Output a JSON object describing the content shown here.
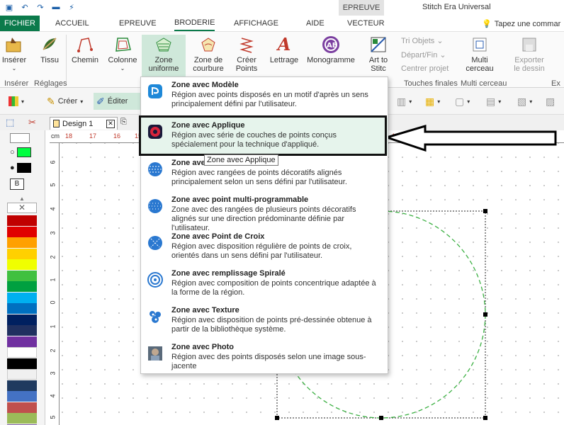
{
  "titlebar": {
    "context_tab": "EPREUVE",
    "app_title": "Stitch Era Universal",
    "qat_icons": [
      "save-icon",
      "undo-icon",
      "redo-icon",
      "folder-icon",
      "wand-icon"
    ]
  },
  "tabs": {
    "file": "FICHIER",
    "items": [
      "ACCUEIL",
      "EPREUVE",
      "BRODERIE",
      "AFFICHAGE",
      "AIDE",
      "VECTEUR"
    ],
    "active": "BRODERIE",
    "tellme": "Tapez une commar"
  },
  "ribbon": {
    "btn_inserer": "Insérer",
    "btn_tissu": "Tissu",
    "btn_chemin": "Chemin",
    "btn_colonne": "Colonne",
    "btn_zone_uniforme_1": "Zone",
    "btn_zone_uniforme_2": "uniforme",
    "btn_zone_courbure_1": "Zone de",
    "btn_zone_courbure_2": "courbure",
    "btn_creer_points_1": "Créer",
    "btn_creer_points_2": "Points",
    "btn_lettrage": "Lettrage",
    "btn_monogramme": "Monogramme",
    "btn_art_stitch_1": "Art to",
    "btn_art_stitch_2": "Stitc",
    "small_tri": "Tri Objets",
    "small_depart": "Départ/Fin",
    "small_centrer": "Centrer projet",
    "btn_multi_1": "Multi",
    "btn_multi_2": "cerceau",
    "btn_exporter_1": "Exporter",
    "btn_exporter_2": "le dessin",
    "grp_inserer": "Insérer",
    "grp_reglages": "Réglages",
    "grp_touches": "Touches finales",
    "grp_multi": "Multi cerceau",
    "grp_ex": "Ex"
  },
  "toolbar2": {
    "creer": "Créer",
    "editer": "Éditer"
  },
  "doc": {
    "tab_label": "Design 1"
  },
  "ruler": {
    "unit": "cm",
    "h_ticks": [
      "18",
      "17",
      "16",
      "15",
      "4",
      "2",
      "1",
      "0",
      "1",
      "2"
    ],
    "v_ticks": [
      "6",
      "5",
      "4",
      "3",
      "2",
      "1",
      "0",
      "1",
      "2",
      "3",
      "4",
      "5"
    ]
  },
  "palette": {
    "b_label": "B",
    "colors": [
      "#c00000",
      "#e00000",
      "#ffa000",
      "#ffd000",
      "#f0ff00",
      "#40c040",
      "#00a040",
      "#00b0f0",
      "#0070c0",
      "#002060",
      "#203060",
      "#7030a0",
      "#ffffff",
      "#000000",
      "#f0f0f0",
      "#1f3a5f",
      "#4472c4",
      "#c0504d",
      "#9bbb59",
      "#8064a2"
    ],
    "accent_green": "#00ff40"
  },
  "menu": {
    "items": [
      {
        "title": "Zone avec Modèle",
        "desc": "Région avec points disposés en un motif d'après un sens principalement défini par l'utilisateur.",
        "icon": "modele-icon"
      },
      {
        "title": "Zone avec Applique",
        "desc": "Région avec série de couches de points conçus spécialement pour la technique d'appliqué.",
        "icon": "applique-icon"
      },
      {
        "title": "Zone ave",
        "desc": "Région avec rangées de points décoratifs alignés principalement selon un sens défini par l'utilisateur.",
        "icon": "decoratif-icon"
      },
      {
        "title": "Zone avec point multi-programmable",
        "desc": "Zone avec des rangées de plusieurs points décoratifs alignés sur une direction prédominante définie par l'utilisateur.",
        "icon": "multi-programmable-icon"
      },
      {
        "title": "Zone avec Point de Croix",
        "desc": "Région avec disposition régulière de points de croix, orientés dans un sens défini par l'utilisateur.",
        "icon": "croix-icon"
      },
      {
        "title": "Zone avec remplissage Spiralé",
        "desc": "Région avec composition de points concentrique adaptée à la forme de la région.",
        "icon": "spirale-icon"
      },
      {
        "title": "Zone avec Texture",
        "desc": "Région avec disposition de points pré-dessinée obtenue à partir de la bibliothèque système.",
        "icon": "texture-icon"
      },
      {
        "title": "Zone avec Photo",
        "desc": "Région avec des points disposés selon une image sous-jacente",
        "icon": "photo-icon"
      }
    ],
    "tooltip": "Zone avec Applique"
  },
  "colors": {
    "brand_green": "#0b7a4b",
    "selected_bg": "#cfe8da",
    "circle_stroke": "#3cb043"
  }
}
